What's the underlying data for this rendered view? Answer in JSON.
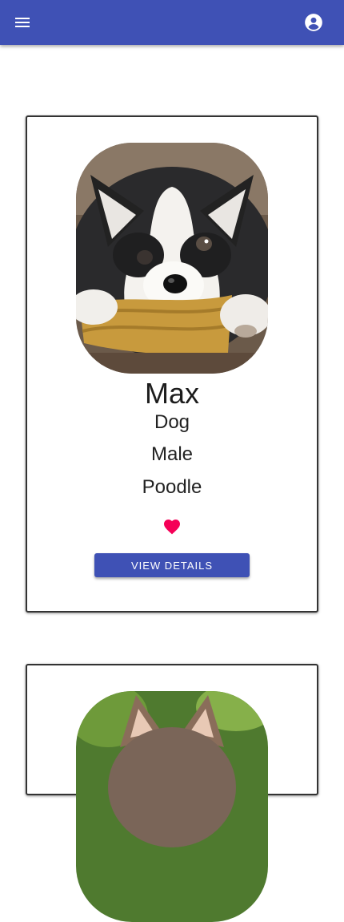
{
  "app_bar": {
    "menu_icon": "menu-icon",
    "account_icon": "account-circle-icon",
    "color": "#3f51b5"
  },
  "pets": [
    {
      "name": "Max",
      "type": "Dog",
      "sex": "Male",
      "breed": "Poodle",
      "favorite_icon": "heart-icon",
      "favorite_color": "#f50057",
      "button_label": "VIEW DETAILS"
    }
  ],
  "colors": {
    "primary": "#3f51b5",
    "accent": "#f50057"
  }
}
